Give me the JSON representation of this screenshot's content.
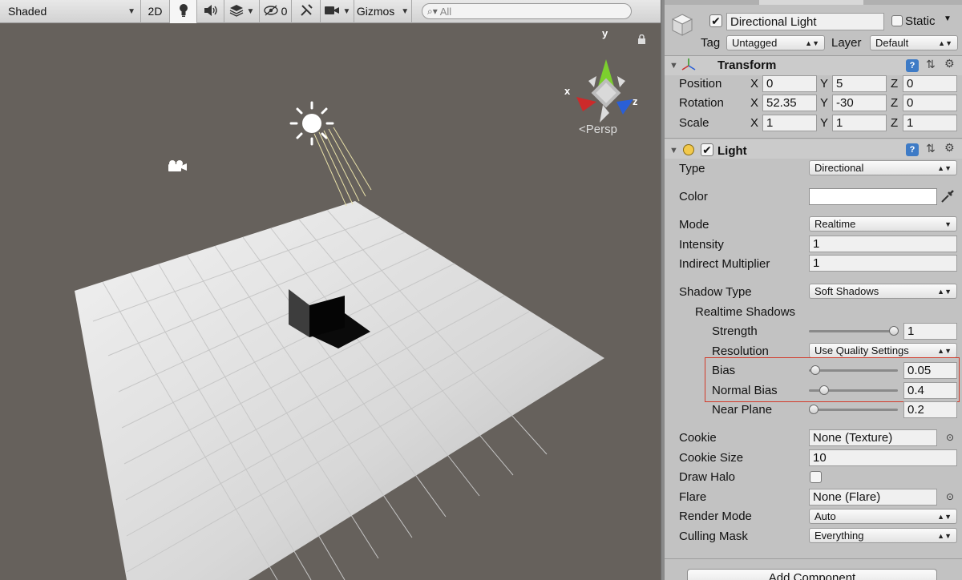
{
  "scene_toolbar": {
    "shading_mode": "Shaded",
    "mode_2d": "2D",
    "hidden_count": "0",
    "gizmos_label": "Gizmos",
    "search_placeholder": "All"
  },
  "scene_view": {
    "persp_label": "Persp",
    "axis_x": "x",
    "axis_y": "y",
    "axis_z": "z"
  },
  "inspector": {
    "object": {
      "active": true,
      "name": "Directional Light",
      "static_label": "Static",
      "static": false,
      "tag_label": "Tag",
      "tag_value": "Untagged",
      "layer_label": "Layer",
      "layer_value": "Default"
    },
    "transform": {
      "title": "Transform",
      "position_label": "Position",
      "rotation_label": "Rotation",
      "scale_label": "Scale",
      "x": "X",
      "y": "Y",
      "z": "Z",
      "position": [
        "0",
        "5",
        "0"
      ],
      "rotation": [
        "52.35",
        "-30",
        "0"
      ],
      "scale": [
        "1",
        "1",
        "1"
      ]
    },
    "light": {
      "title": "Light",
      "enabled": true,
      "type_label": "Type",
      "type_value": "Directional",
      "color_label": "Color",
      "color_value": "#ffffff",
      "mode_label": "Mode",
      "mode_value": "Realtime",
      "intensity_label": "Intensity",
      "intensity_value": "1",
      "indirect_label": "Indirect Multiplier",
      "indirect_value": "1",
      "shadow_type_label": "Shadow Type",
      "shadow_type_value": "Soft Shadows",
      "realtime_shadows_label": "Realtime Shadows",
      "strength_label": "Strength",
      "strength_value": "1",
      "resolution_label": "Resolution",
      "resolution_value": "Use Quality Settings",
      "bias_label": "Bias",
      "bias_value": "0.05",
      "normal_bias_label": "Normal Bias",
      "normal_bias_value": "0.4",
      "near_plane_label": "Near Plane",
      "near_plane_value": "0.2",
      "cookie_label": "Cookie",
      "cookie_value": "None (Texture)",
      "cookie_size_label": "Cookie Size",
      "cookie_size_value": "10",
      "draw_halo_label": "Draw Halo",
      "draw_halo": false,
      "flare_label": "Flare",
      "flare_value": "None (Flare)",
      "render_mode_label": "Render Mode",
      "render_mode_value": "Auto",
      "culling_mask_label": "Culling Mask",
      "culling_mask_value": "Everything"
    },
    "add_component_label": "Add Component"
  }
}
